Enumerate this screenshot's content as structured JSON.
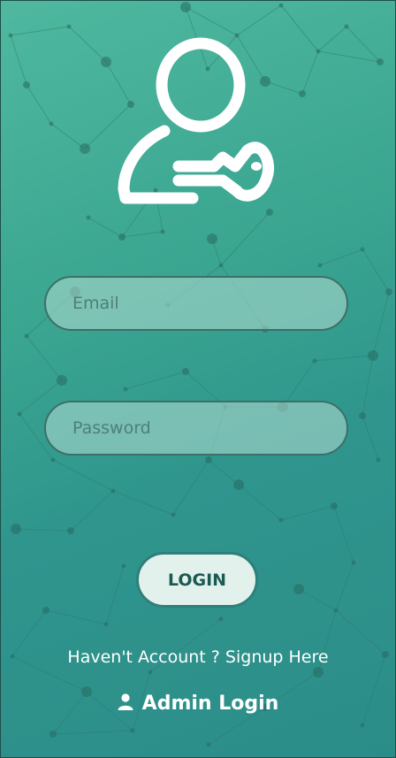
{
  "form": {
    "email_placeholder": "Email",
    "password_placeholder": "Password",
    "login_label": "LOGIN"
  },
  "links": {
    "signup_label": "Haven't Account ? Signup Here",
    "admin_label": "Admin Login"
  },
  "icons": {
    "logo": "user-key-icon",
    "admin": "person-icon"
  },
  "colors": {
    "background_top": "#4fb89f",
    "background_bottom": "#2c8d88",
    "accent_dark": "#1b5954",
    "button_fill": "#e2f1ec"
  }
}
